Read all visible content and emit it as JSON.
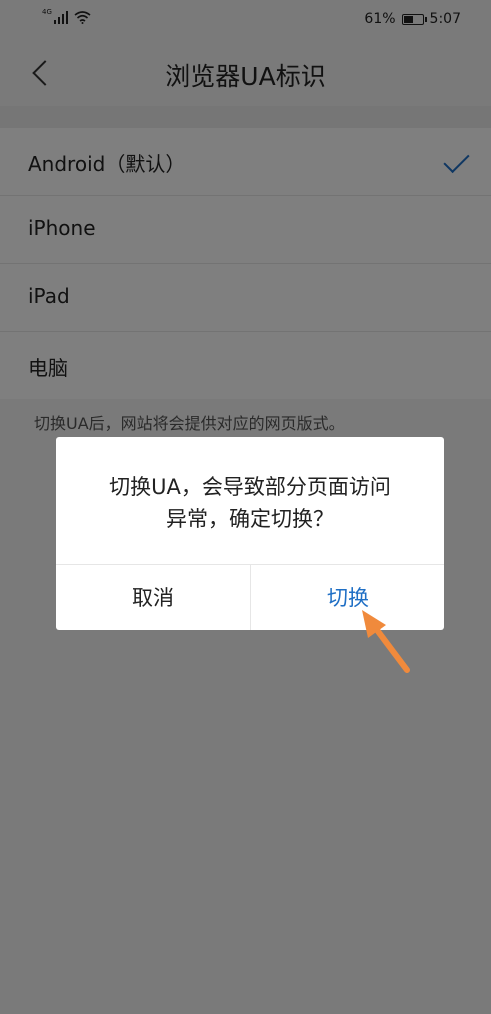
{
  "status_bar": {
    "network": "4G",
    "battery_text": "61%",
    "battery_level": 0.61,
    "time": "5:07"
  },
  "nav": {
    "back_icon": "chevron-left-icon",
    "title": "浏览器UA标识"
  },
  "ua_options": [
    {
      "label": "Android（默认）",
      "selected": true
    },
    {
      "label": "iPhone",
      "selected": false
    },
    {
      "label": "iPad",
      "selected": false
    },
    {
      "label": "电脑",
      "selected": false
    }
  ],
  "hint": "切换UA后，网站将会提供对应的网页版式。",
  "dialog": {
    "message_line1": "切换UA，会导致部分页面访问",
    "message_line2": "异常，确定切换？",
    "cancel_label": "取消",
    "confirm_label": "切换"
  },
  "colors": {
    "accent": "#1f6fc5",
    "annotation_arrow": "#f08a3c"
  }
}
